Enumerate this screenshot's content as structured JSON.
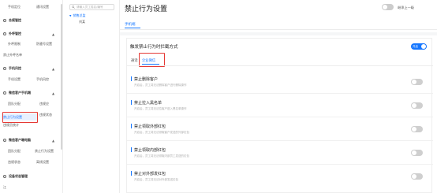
{
  "sidebar": {
    "row1": [
      "手机定位",
      "通讯设置"
    ],
    "sec1": "合规管控",
    "sec2": "外呼管控",
    "row2": [
      "外呼限制",
      "防骚号设置"
    ],
    "row3": "禁止外呼名单",
    "sec3": "手机风控",
    "row4": [
      "手机设置",
      "手机风控"
    ],
    "sec4": "微信客户手机端",
    "row5": [
      "团队分配",
      "违规应"
    ],
    "active": "禁止行为设置",
    "active_peer": "违规状态",
    "row7": "违规员统计",
    "sec5": "微信客户端电脑",
    "row8": [
      "团队分配",
      "禁止行为设置"
    ],
    "row9": [
      "违规状态",
      "离线设置"
    ],
    "sec6": "设备状态管理",
    "bottom": "江"
  },
  "tree": {
    "search_placeholder": "请输入员工姓名/编号",
    "root": "销售总监",
    "child": "刘某"
  },
  "main": {
    "title": "禁止行为设置",
    "inherit_label": "继承上一级",
    "tab": "手机端",
    "panel_title": "触发禁止行为时拦截方式",
    "panel_switch": "开启",
    "subtabs": [
      "通话",
      "企业微信"
    ],
    "rules": [
      {
        "name": "禁止删除客户",
        "desc": "开启后，员工将无法删除客户进行删除操作"
      },
      {
        "name": "禁止拉入黑名单",
        "desc": "开启后，员工将无法拉客户进入黑名单操作"
      },
      {
        "name": "禁止领取外部红包",
        "desc": "开启后，员工将无法领取客户发送的外部红包"
      },
      {
        "name": "禁止领取内部红包",
        "desc": "开启后，员工将无法领取内部员工发送的红包"
      },
      {
        "name": "禁止对外部发红包",
        "desc": "开启后，员工将无法对外部发送红包"
      }
    ]
  },
  "colors": {
    "accent": "#1677ff",
    "highlight_box": "#e53935"
  }
}
